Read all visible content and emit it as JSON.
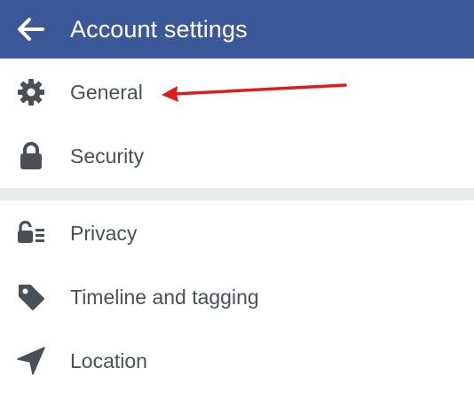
{
  "header": {
    "title": "Account settings",
    "background_color": "#3b5998",
    "back_icon": "arrow-left-icon"
  },
  "menu": {
    "items": [
      {
        "label": "General",
        "icon": "gear-icon"
      },
      {
        "label": "Security",
        "icon": "lock-icon"
      },
      {
        "label": "Privacy",
        "icon": "privacy-lock-list-icon"
      },
      {
        "label": "Timeline and tagging",
        "icon": "tag-icon"
      },
      {
        "label": "Location",
        "icon": "location-arrow-icon"
      }
    ],
    "icon_color": "#4b4f56",
    "text_color": "#4b4f56",
    "divider_color": "#e6ebeb"
  },
  "annotation": {
    "arrow_color": "#e01b1b"
  }
}
